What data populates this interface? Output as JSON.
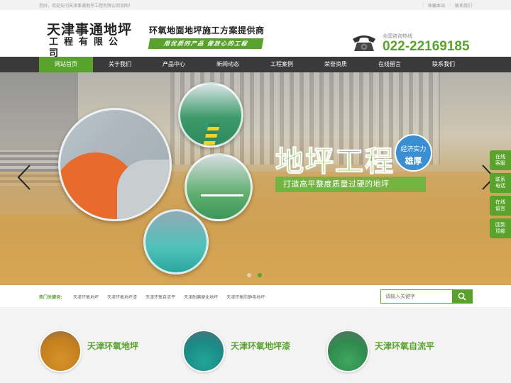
{
  "topbar": {
    "welcome": "您好，欢迎访问天津事通地坪工程有限公司官网！",
    "favorite": "收藏本站",
    "contact": "联系我们"
  },
  "header": {
    "logo_line1": "天津事通地坪",
    "logo_line2": "工程有限公司",
    "slogan_title": "环氧地面地坪施工方案提供商",
    "slogan_sub": "用优质的产品 做放心的工程",
    "hotline_label": "全国咨询热线",
    "hotline_number": "022-22169185"
  },
  "nav": {
    "items": [
      "网站首页",
      "关于我们",
      "产品中心",
      "新闻动态",
      "工程案例",
      "荣誉资质",
      "在线留言",
      "联系我们"
    ],
    "active_index": 0
  },
  "banner": {
    "title": "地坪工程",
    "badge_line1": "经济实力",
    "badge_line2": "雄厚",
    "tagline": "打造高平整度质量过硬的地坪",
    "slide_count": 2,
    "active_slide": 1
  },
  "sidefloat": {
    "items": [
      "在线\n客服",
      "联系\n电话",
      "在线\n留言",
      "回到\n顶部"
    ]
  },
  "hot": {
    "label": "热门关键词：",
    "keywords": [
      "天津环氧地坪",
      "天津环氧地坪漆",
      "天津环氧自流平",
      "天津耐磨硬化地坪",
      "天津环氧防静电地坪"
    ]
  },
  "search": {
    "placeholder": "请输入关键字"
  },
  "products": {
    "items": [
      "天津环氧地坪",
      "天津环氧地坪漆",
      "天津环氧自流平"
    ]
  },
  "colors": {
    "accent": "#59a32d",
    "nav_bg": "#3a3a3a"
  }
}
